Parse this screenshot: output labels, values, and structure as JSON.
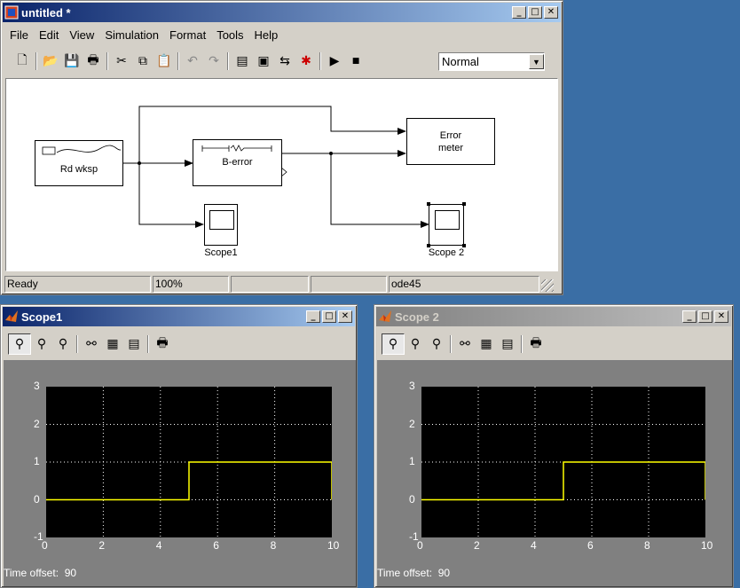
{
  "model_window": {
    "title": "untitled *",
    "menu": [
      "File",
      "Edit",
      "View",
      "Simulation",
      "Format",
      "Tools",
      "Help"
    ],
    "sim_mode": "Normal",
    "blocks": {
      "read_wksp": "Rd wksp",
      "b_error": "B-error",
      "error_meter_line1": "Error",
      "error_meter_line2": "meter",
      "scope1": "Scope1",
      "scope2": "Scope 2"
    },
    "status": {
      "state": "Ready",
      "zoom": "100%",
      "field3": "",
      "field4": "",
      "solver": "ode45"
    }
  },
  "scope1": {
    "title": "Scope1",
    "time_offset_label": "Time offset:",
    "time_offset_value": "90"
  },
  "scope2": {
    "title": "Scope 2",
    "time_offset_label": "Time offset:",
    "time_offset_value": "90"
  },
  "chart_data": [
    {
      "type": "line",
      "x_ticks": [
        "0",
        "2",
        "4",
        "6",
        "8",
        "10"
      ],
      "y_ticks": [
        "3",
        "2",
        "1",
        "0",
        "-1"
      ],
      "xlim": [
        0,
        10
      ],
      "ylim": [
        -1,
        3
      ],
      "grid": true,
      "series": [
        {
          "x": [
            0,
            5,
            5,
            10,
            10
          ],
          "y": [
            0,
            0,
            1,
            1,
            0
          ],
          "color": "#ffff00"
        }
      ]
    },
    {
      "type": "line",
      "x_ticks": [
        "0",
        "2",
        "4",
        "6",
        "8",
        "10"
      ],
      "y_ticks": [
        "3",
        "2",
        "1",
        "0",
        "-1"
      ],
      "xlim": [
        0,
        10
      ],
      "ylim": [
        -1,
        3
      ],
      "grid": true,
      "series": [
        {
          "x": [
            0,
            5,
            5,
            10,
            10
          ],
          "y": [
            0,
            0,
            1,
            1,
            0
          ],
          "color": "#ffff00"
        }
      ]
    }
  ]
}
